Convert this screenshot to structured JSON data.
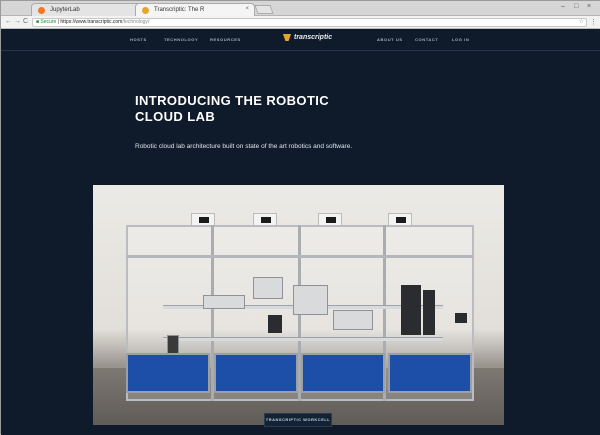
{
  "browser": {
    "tabs": [
      {
        "title": "JupyterLab",
        "favicon_color": "#f37626",
        "close": "×"
      },
      {
        "title": "Transcriptic: The R",
        "favicon_color": "#e3a52c",
        "close": "×"
      }
    ],
    "address": {
      "secure_label": "Secure",
      "host": "https://www.transcriptic.com",
      "path": "/technology/"
    },
    "window_controls": [
      "–",
      "□",
      "×"
    ],
    "nav_buttons": {
      "back": "←",
      "forward": "→",
      "reload": "C"
    },
    "menu_icon": "⋮"
  },
  "site_nav": {
    "left_items": [
      "HOSTS",
      "TECHNOLOGY",
      "RESOURCES"
    ],
    "logo_text": "transcriptic",
    "right_items": [
      "ABOUT US",
      "CONTACT",
      "LOG IN"
    ]
  },
  "hero": {
    "title_line1": "INTRODUCING THE ROBOTIC",
    "title_line2": "CLOUD LAB",
    "subtitle": "Robotic cloud lab architecture built on state of the art robotics and software."
  },
  "image_caption": "TRANSCRIPTIC WORKCELL",
  "colors": {
    "page_bg": "#0f1a2a",
    "accent": "#e3a52c",
    "panel_blue": "#1e4fa8"
  }
}
